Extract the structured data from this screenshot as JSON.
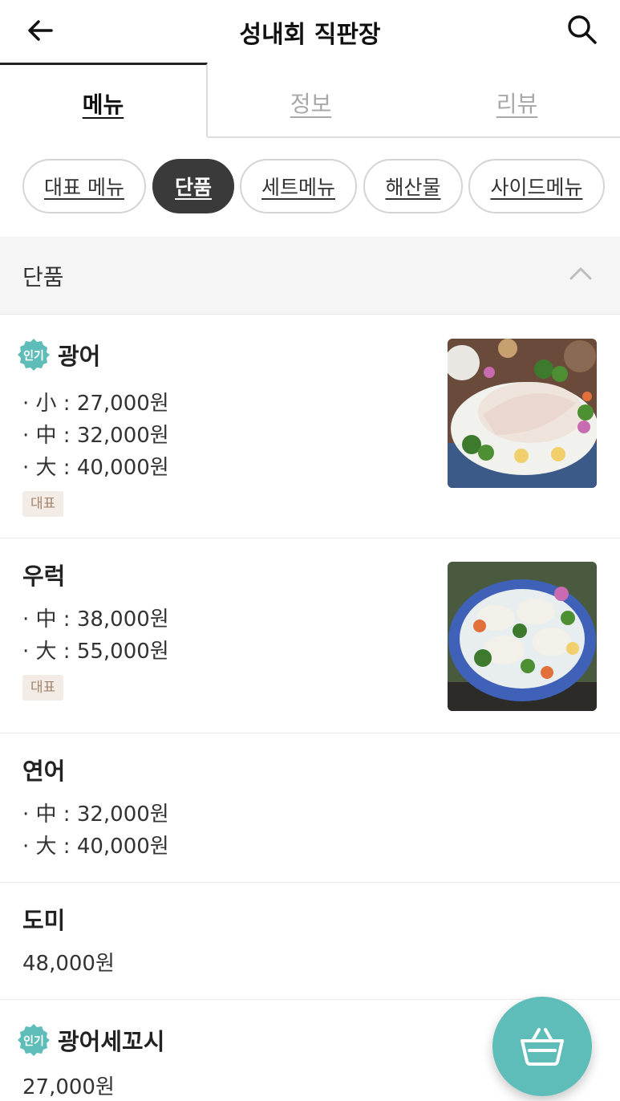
{
  "header": {
    "title": "성내회 직판장",
    "back_icon": "arrow-left-icon",
    "search_icon": "search-icon"
  },
  "tabs": [
    {
      "label": "메뉴",
      "active": true
    },
    {
      "label": "정보",
      "active": false
    },
    {
      "label": "리뷰",
      "active": false
    }
  ],
  "categories": [
    {
      "label": "대표 메뉴",
      "active": false
    },
    {
      "label": "단품",
      "active": true
    },
    {
      "label": "세트메뉴",
      "active": false
    },
    {
      "label": "해산물",
      "active": false
    },
    {
      "label": "사이드메뉴",
      "active": false
    }
  ],
  "section": {
    "label": "단품",
    "toggle_icon": "chevron-up-icon"
  },
  "popular_badge": "인기",
  "signature_tag": "대표",
  "items": [
    {
      "name": "광어",
      "popular": true,
      "prices": [
        "· 小 : 27,000원",
        "· 中 : 32,000원",
        "· 大 : 40,000원"
      ],
      "signature": true,
      "has_image": true
    },
    {
      "name": "우럭",
      "popular": false,
      "prices": [
        "· 中 : 38,000원",
        "· 大 : 55,000원"
      ],
      "signature": true,
      "has_image": true
    },
    {
      "name": "연어",
      "popular": false,
      "prices": [
        "· 中 : 32,000원",
        "· 大 : 40,000원"
      ],
      "signature": false,
      "has_image": false
    },
    {
      "name": "도미",
      "popular": false,
      "prices": [
        "48,000원"
      ],
      "signature": false,
      "has_image": false
    },
    {
      "name": "광어세꼬시",
      "popular": true,
      "prices": [
        "27,000원"
      ],
      "signature": false,
      "has_image": false
    }
  ],
  "cart": {
    "icon": "shopping-basket-icon",
    "color": "#5fbdb9"
  }
}
